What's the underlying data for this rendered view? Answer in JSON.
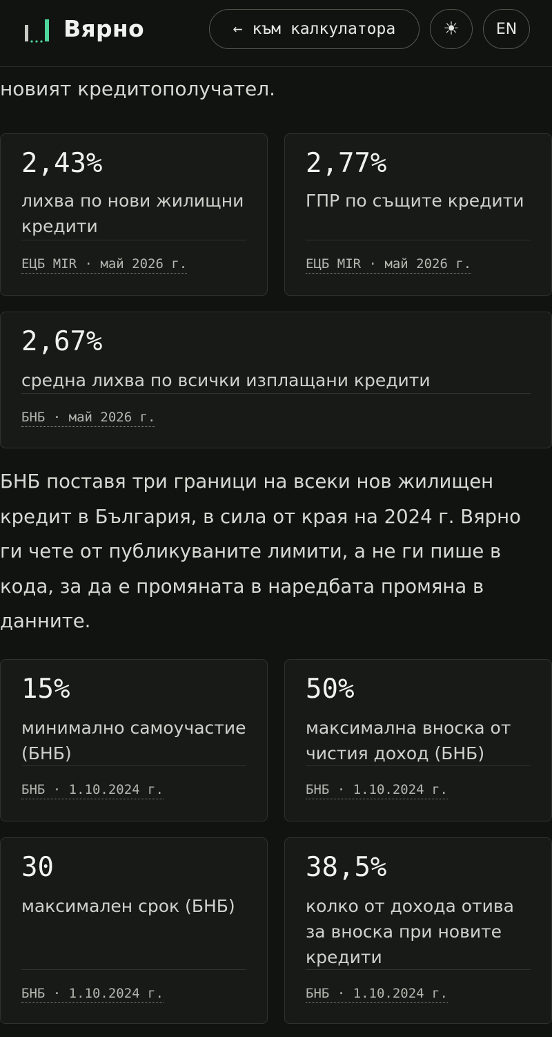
{
  "header": {
    "brand": "Вярно",
    "back_label": "← към калкулатора",
    "theme_icon": "sun-icon",
    "theme_glyph": "☀",
    "lang_label": "EN",
    "accent_color": "#4fd69c"
  },
  "intro_tail": "новият кредитополучател.",
  "rate_cards": [
    {
      "value": "2,43%",
      "desc": "лихва по нови жилищни кредити",
      "source": "ЕЦБ MIR · май 2026 г."
    },
    {
      "value": "2,77%",
      "desc": "ГПР по същите кредити",
      "source": "ЕЦБ MIR · май 2026 г."
    },
    {
      "value": "2,67%",
      "desc": "средна лихва по всички изплащани кредити",
      "source": "БНБ · май 2026 г."
    }
  ],
  "paragraph": "БНБ поставя три граници на всеки нов жилищен кредит в България, в сила от края на 2024 г. Вярно ги чете от публикуваните лимити, а не ги пише в кода, за да е промяната в наредбата промяна в данните.",
  "limit_cards": [
    {
      "value": "15%",
      "desc": "минимално самоучастие (БНБ)",
      "source": "БНБ · 1.10.2024 г."
    },
    {
      "value": "50%",
      "desc": "максимална вноска от чистия доход (БНБ)",
      "source": "БНБ · 1.10.2024 г."
    },
    {
      "value": "30",
      "desc": "максимален срок (БНБ)",
      "source": "БНБ · 1.10.2024 г."
    },
    {
      "value": "38,5%",
      "desc": "колко от дохода отива за вноска при новите кредити",
      "source": "БНБ · 1.10.2024 г."
    }
  ]
}
